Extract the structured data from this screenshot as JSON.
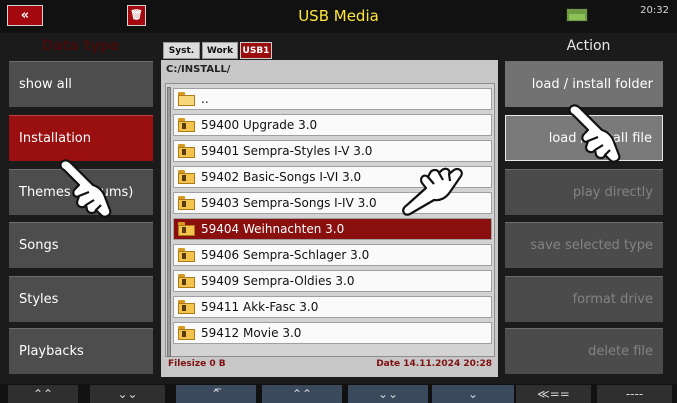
{
  "topbar": {
    "back_label": "«",
    "trash_label": "🗑",
    "title": "USB Media",
    "clock": "20:32"
  },
  "headers": {
    "data_type": "Data type",
    "action": "Action"
  },
  "data_type_buttons": [
    {
      "label": "show all",
      "selected": false
    },
    {
      "label": "Installation",
      "selected": true
    },
    {
      "label": "Themes (Albums)",
      "selected": false
    },
    {
      "label": "Songs",
      "selected": false
    },
    {
      "label": "Styles",
      "selected": false
    },
    {
      "label": "Playbacks",
      "selected": false
    }
  ],
  "action_buttons": [
    {
      "label": "load / install folder",
      "state": "active"
    },
    {
      "label": "load / install file",
      "state": "outlined"
    },
    {
      "label": "play directly",
      "state": "dim"
    },
    {
      "label": "save selected type",
      "state": "dim"
    },
    {
      "label": "format drive",
      "state": "dim"
    },
    {
      "label": "delete file",
      "state": "dim"
    }
  ],
  "tabs": {
    "syst": "Syst.",
    "work": "Work",
    "usb1": "USB1"
  },
  "browser": {
    "path": "C:/INSTALL/",
    "parent_label": "..",
    "items": [
      {
        "name": "59400 Upgrade 3.0",
        "selected": false
      },
      {
        "name": "59401 Sempra-Styles I-V 3.0",
        "selected": false
      },
      {
        "name": "59402 Basic-Songs I-VI 3.0",
        "selected": false
      },
      {
        "name": "59403 Sempra-Songs I-IV 3.0",
        "selected": false
      },
      {
        "name": "59404 Weihnachten 3.0",
        "selected": true
      },
      {
        "name": "59406 Sempra-Schlager 3.0",
        "selected": false
      },
      {
        "name": "59409 Sempra-Oldies 3.0",
        "selected": false
      },
      {
        "name": "59411 Akk-Fasc 3.0",
        "selected": false
      },
      {
        "name": "59412 Movie 3.0",
        "selected": false
      }
    ],
    "filesize": "Filesize 0 B",
    "date": "Date 14.11.2024 20:28"
  },
  "bottom_nav": [
    {
      "label": "⌃⌃",
      "name": "page-up"
    },
    {
      "label": "⌄⌄",
      "name": "page-down"
    },
    {
      "label": "⌃̅",
      "name": "list-top"
    },
    {
      "label": "⌃⌃",
      "name": "list-page-up"
    },
    {
      "label": "⌄⌄",
      "name": "list-page-down"
    },
    {
      "label": "⌄",
      "name": "list-down"
    },
    {
      "label": "≪==",
      "name": "back-nav"
    },
    {
      "label": "----",
      "name": "empty"
    }
  ],
  "colors": {
    "accent_red": "#9a0f0f",
    "title_yellow": "#ffe53a"
  }
}
